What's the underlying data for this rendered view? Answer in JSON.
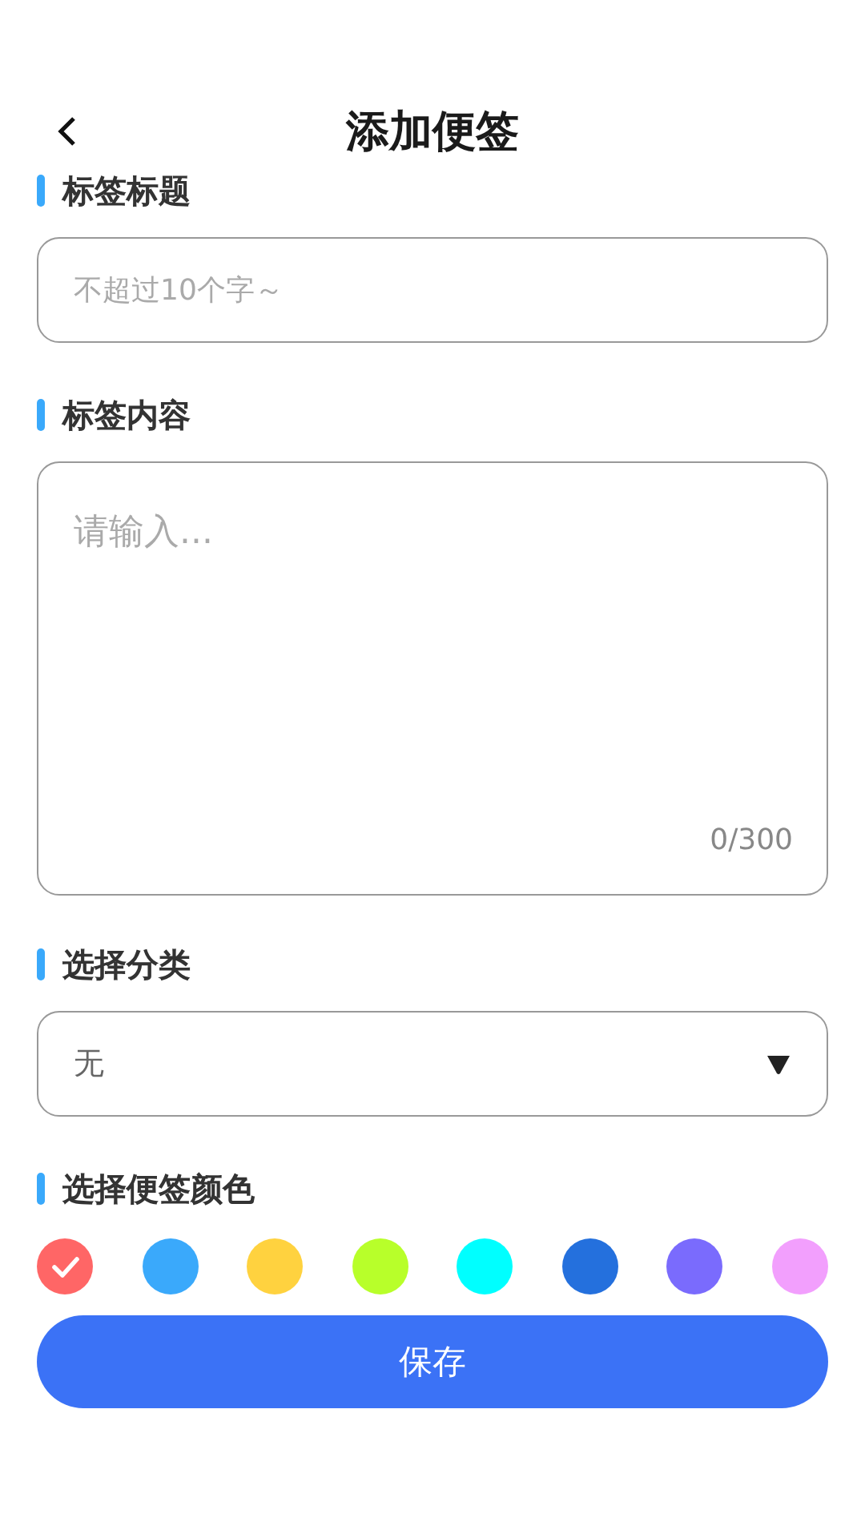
{
  "header": {
    "title": "添加便签"
  },
  "title_section": {
    "label": "标签标题",
    "placeholder": "不超过10个字～"
  },
  "content_section": {
    "label": "标签内容",
    "placeholder": "请输入...",
    "counter": "0/300"
  },
  "category_section": {
    "label": "选择分类",
    "value": "无"
  },
  "color_section": {
    "label": "选择便签颜色",
    "colors": [
      {
        "color": "#ff6666",
        "selected": true
      },
      {
        "color": "#3aa9fb",
        "selected": false
      },
      {
        "color": "#ffd23f",
        "selected": false
      },
      {
        "color": "#b8ff2a",
        "selected": false
      },
      {
        "color": "#00ffff",
        "selected": false
      },
      {
        "color": "#2470dd",
        "selected": false
      },
      {
        "color": "#7a6bfd",
        "selected": false
      },
      {
        "color": "#f29ffd",
        "selected": false
      }
    ]
  },
  "save_button": {
    "label": "保存"
  }
}
